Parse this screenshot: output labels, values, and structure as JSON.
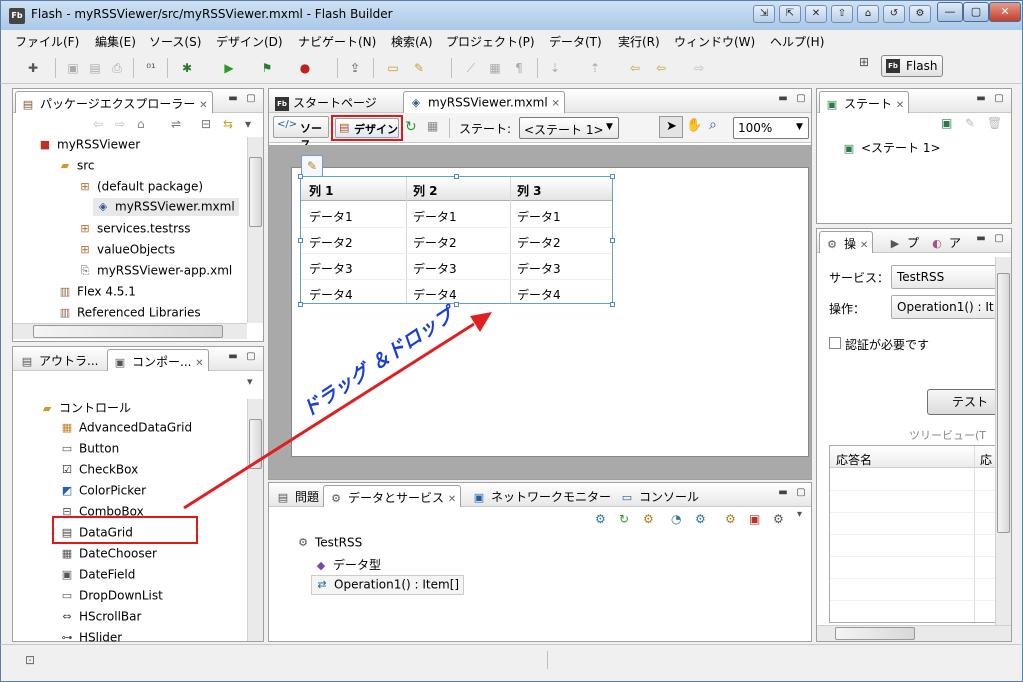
{
  "window": {
    "title": "Flash - myRSSViewer/src/myRSSViewer.mxml - Flash Builder",
    "app_icon": "Fb"
  },
  "menu": [
    "ファイル(F)",
    "編集(E)",
    "ソース(S)",
    "デザイン(D)",
    "ナビゲート(N)",
    "検索(A)",
    "プロジェクト(P)",
    "データ(T)",
    "実行(R)",
    "ウィンドウ(W)",
    "ヘルプ(H)"
  ],
  "perspective": {
    "label": "Flash",
    "icon": "Fb"
  },
  "package_explorer": {
    "title": "パッケージエクスプローラー",
    "items": [
      {
        "label": "myRSSViewer",
        "icon": "project-icon"
      },
      {
        "label": "src",
        "icon": "folder-icon"
      },
      {
        "label": "(default package)",
        "icon": "package-icon"
      },
      {
        "label": "myRSSViewer.mxml",
        "icon": "mxml-file-icon"
      },
      {
        "label": "services.testrss",
        "icon": "package-icon"
      },
      {
        "label": "valueObjects",
        "icon": "package-icon"
      },
      {
        "label": "myRSSViewer-app.xml",
        "icon": "xml-file-icon"
      },
      {
        "label": "Flex 4.5.1",
        "icon": "library-icon"
      },
      {
        "label": "Referenced Libraries",
        "icon": "library-icon"
      }
    ]
  },
  "components_panel": {
    "tab_outline": "アウトラ...",
    "tab_components": "コンポー...",
    "folder": "コントロール",
    "items": [
      "AdvancedDataGrid",
      "Button",
      "CheckBox",
      "ColorPicker",
      "ComboBox",
      "DataGrid",
      "DateChooser",
      "DateField",
      "DropDownList",
      "HScrollBar",
      "HSlider"
    ]
  },
  "editor": {
    "tab_start": "スタートページ",
    "tab_file": "myRSSViewer.mxml",
    "source_btn": "ソース",
    "design_btn": "デザイン",
    "state_label": "ステート:",
    "state_value": "<ステート 1>",
    "zoom": "100%"
  },
  "datagrid": {
    "columns": [
      "列 1",
      "列 2",
      "列 3"
    ],
    "rows": [
      [
        "データ1",
        "データ1",
        "データ1"
      ],
      [
        "データ2",
        "データ2",
        "データ2"
      ],
      [
        "データ3",
        "データ3",
        "データ3"
      ],
      [
        "データ4",
        "データ4",
        "データ4"
      ]
    ]
  },
  "annotation": {
    "text": "ドラッグ ＆ドロップ",
    "color": "#1a3fd6",
    "arrow_color": "#e02020"
  },
  "states_panel": {
    "title": "ステート",
    "item": "<ステート 1>"
  },
  "operation_panel": {
    "tab1": "操",
    "tab2": "プ",
    "tab3": "ア",
    "service_label": "サービス：",
    "service_value": "TestRSS",
    "operation_label": "操作：",
    "operation_value": "Operation1() : It",
    "auth_label": "認証が必要です",
    "test_button": "テスト",
    "tree_view": "ツリービュー(T",
    "col_response": "応答名",
    "col_response2": "応"
  },
  "bottom_panel": {
    "tabs": [
      "問題",
      "データとサービス",
      "ネットワークモニター",
      "コンソール"
    ],
    "items": [
      "TestRSS",
      "データ型",
      "Operation1() : Item[]"
    ]
  }
}
